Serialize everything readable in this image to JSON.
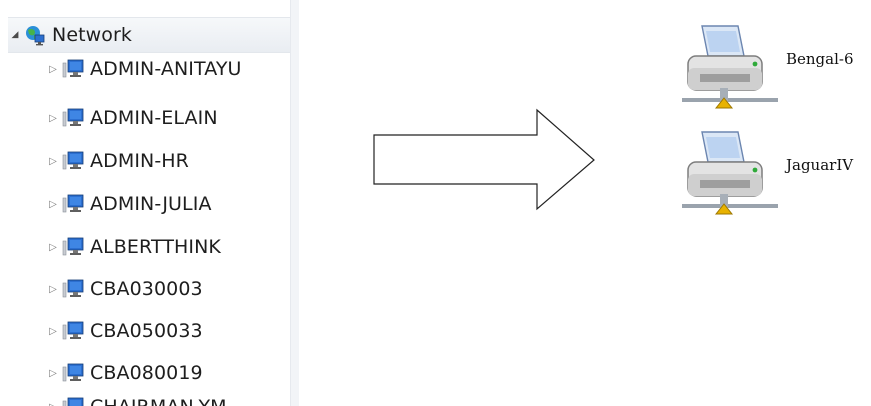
{
  "tree": {
    "root": {
      "label": "Network",
      "icon": "network-globe-icon",
      "expander": "◢"
    },
    "computers": [
      {
        "label": "ADMIN-ANITAYU"
      },
      {
        "label": "ADMIN-ELAIN"
      },
      {
        "label": "ADMIN-HR"
      },
      {
        "label": "ADMIN-JULIA"
      },
      {
        "label": "ALBERTTHINK"
      },
      {
        "label": "CBA030003"
      },
      {
        "label": "CBA050033"
      },
      {
        "label": "CBA080019"
      },
      {
        "label": "CHAIRMAN-YM"
      }
    ],
    "collapsed_glyph": "▷"
  },
  "devices": [
    {
      "label": "Bengal-6",
      "icon": "network-printer-icon"
    },
    {
      "label": "JaguarIV",
      "icon": "network-printer-icon"
    }
  ],
  "colors": {
    "root_row_bg": "#eef1f5",
    "monitor_blue": "#2c6fd0",
    "printer_body": "#d9d9d9",
    "network_cable": "#e8b200"
  }
}
